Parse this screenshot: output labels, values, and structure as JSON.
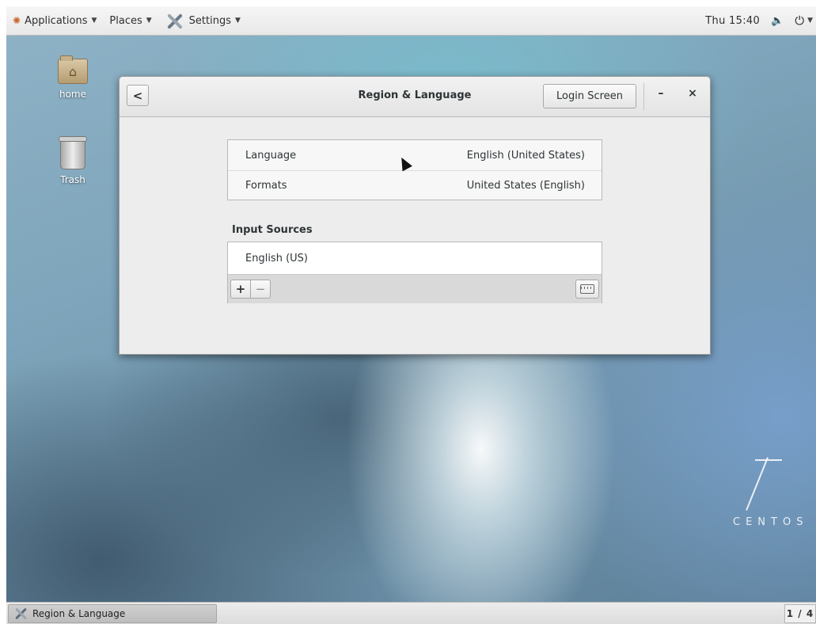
{
  "top_panel": {
    "applications_label": "Applications",
    "places_label": "Places",
    "settings_label": "Settings",
    "clock": "Thu 15:40",
    "volume_icon": "🔈",
    "power_icon": "⏻"
  },
  "desktop": {
    "home_label": "home",
    "trash_label": "Trash",
    "logo_text": "CENTOS"
  },
  "window": {
    "title": "Region & Language",
    "back_symbol": "<",
    "login_button_label": "Login Screen",
    "minimize_symbol": "–",
    "close_symbol": "×",
    "language_row": {
      "label": "Language",
      "value": "English (United States)"
    },
    "formats_row": {
      "label": "Formats",
      "value": "United States (English)"
    },
    "input_sources_title": "Input Sources",
    "input_sources": [
      "English (US)"
    ],
    "add_symbol": "+",
    "remove_symbol": "−"
  },
  "taskbar": {
    "task_label": "Region & Language",
    "workspace": "1 / 4"
  }
}
